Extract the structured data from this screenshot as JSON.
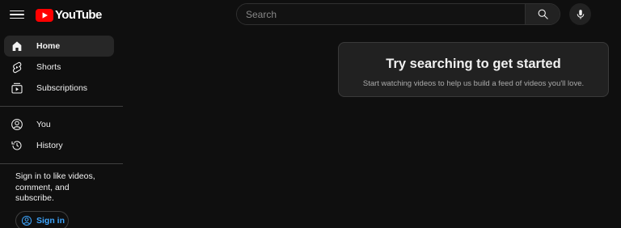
{
  "header": {
    "logo_text": "YouTube",
    "logo_superscript": "",
    "search_placeholder": "Search",
    "brand_color": "#ff0000"
  },
  "sidebar": {
    "items": [
      {
        "label": "Home",
        "icon": "home-icon",
        "active": true
      },
      {
        "label": "Shorts",
        "icon": "shorts-icon",
        "active": false
      },
      {
        "label": "Subscriptions",
        "icon": "subscriptions-icon",
        "active": false
      }
    ],
    "you_items": [
      {
        "label": "You",
        "icon": "you-icon"
      },
      {
        "label": "History",
        "icon": "history-icon"
      }
    ],
    "signin_prompt": "Sign in to like videos, comment, and subscribe.",
    "signin_label": "Sign in",
    "signin_color": "#3ea6ff"
  },
  "main": {
    "card_title": "Try searching to get started",
    "card_subtitle": "Start watching videos to help us build a feed of videos you'll love."
  }
}
